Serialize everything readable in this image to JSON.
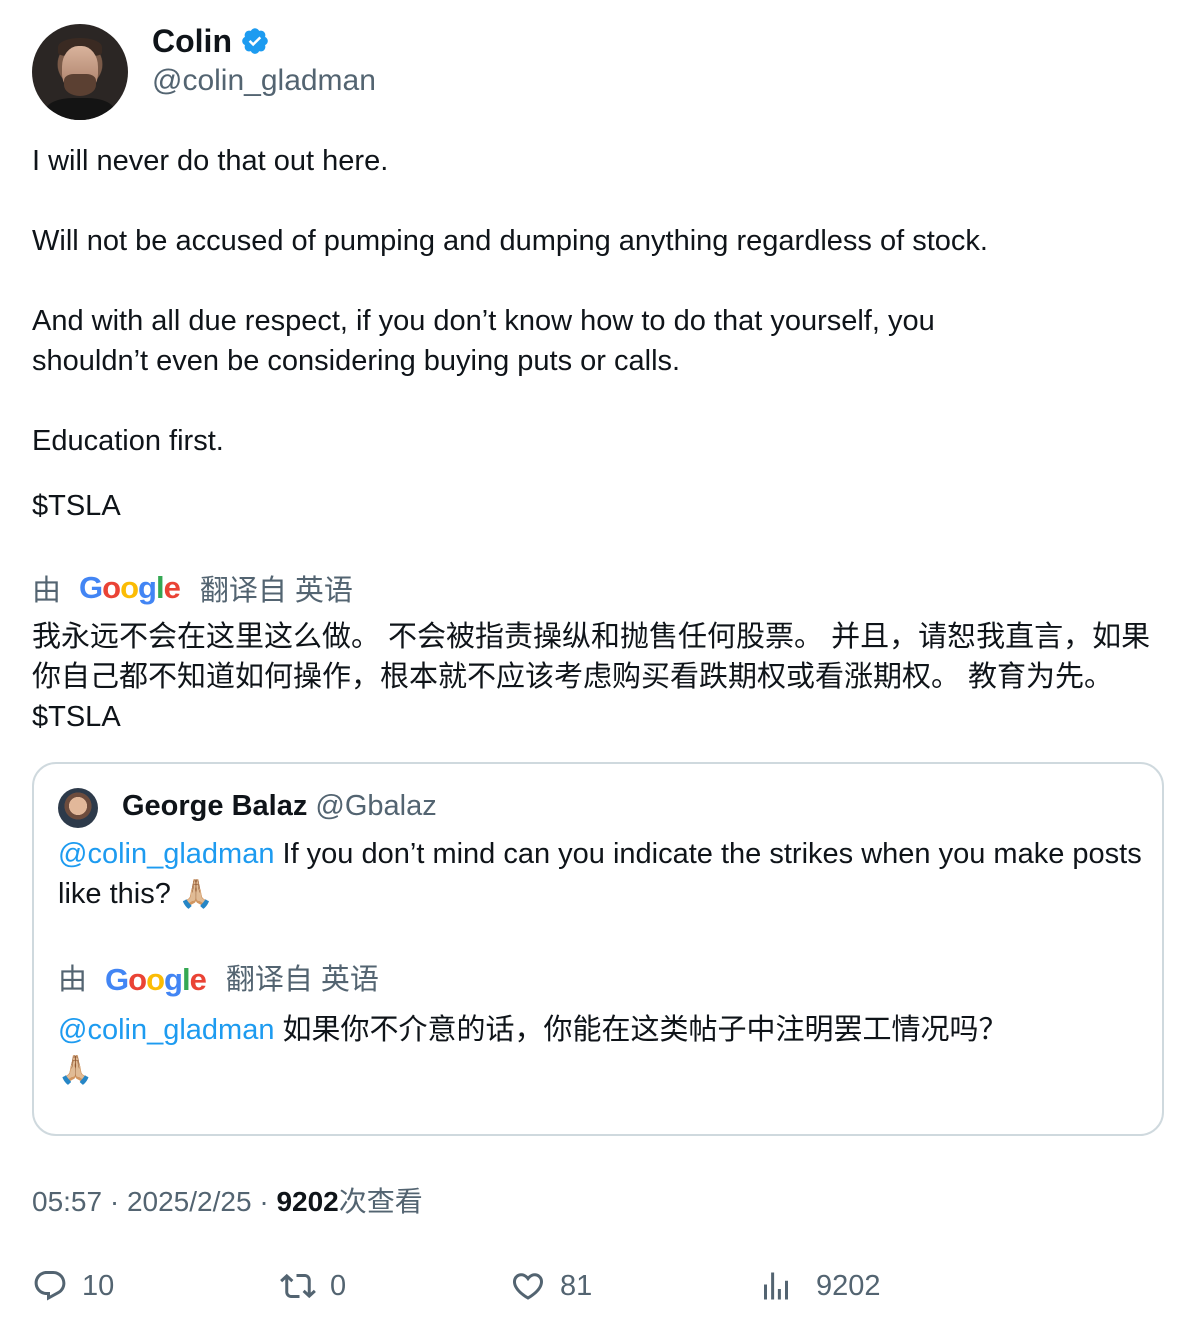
{
  "author": {
    "display_name": "Colin",
    "handle": "@colin_gladman",
    "verified": true
  },
  "tweet": {
    "paragraphs": [
      "I will never do that out here.",
      "Will not be accused of pumping and dumping anything regardless of stock.",
      "And with all due respect, if you don’t know how to do that yourself, you",
      "shouldn’t even be considering buying puts or calls.",
      "Education first.",
      "$TSLA"
    ],
    "translation_prefix": "由",
    "translation_brand": "Google",
    "translation_suffix": "翻译自 英语",
    "translated_text": "我永远不会在这里这么做。 不会被指责操纵和抛售任何股票。 并且，请恕我直言，如果你自己都不知道如何操作，根本就不应该考虑购买看跌期权或看涨期权。 教育为先。 $TSLA"
  },
  "quoted": {
    "display_name": "George Balaz",
    "handle": "@Gbalaz",
    "mention": "@colin_gladman",
    "text": " If you don’t mind can you indicate the strikes when you make posts like this? ",
    "emoji": "🙏🏼",
    "translation_prefix": "由",
    "translation_brand": "Google",
    "translation_suffix": "翻译自 英语",
    "translated_mention": "@colin_gladman",
    "translated_text": " 如果你不介意的话，你能在这类帖子中注明罢工情况吗？",
    "translated_emoji": "🙏🏼"
  },
  "meta": {
    "time": "05:57",
    "separator": " · ",
    "date": "2025/2/25",
    "views_count": "9202",
    "views_label": "次查看"
  },
  "actions": {
    "replies": "10",
    "retweets": "0",
    "likes": "81",
    "views": "9202"
  },
  "colors": {
    "accent": "#1d9bf0",
    "secondary_text": "#536471",
    "border": "#cfd9de"
  }
}
